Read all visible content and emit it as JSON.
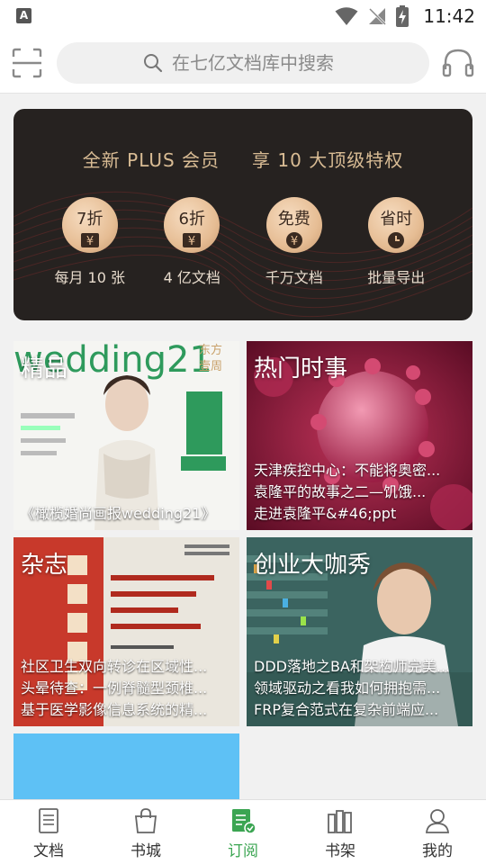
{
  "status_bar": {
    "app_icon_letter": "A",
    "time": "11:42"
  },
  "search": {
    "placeholder": "在七亿文档库中搜索"
  },
  "vip_banner": {
    "title_left": "全新 PLUS 会员",
    "title_right": "享 10 大顶级特权",
    "perks": [
      {
        "badge": "7折",
        "label": "每月 10 张",
        "icon": "yen-coin-icon"
      },
      {
        "badge": "6折",
        "label": "4 亿文档",
        "icon": "yen-coin-icon"
      },
      {
        "badge": "免费",
        "label": "千万文档",
        "icon": "yen-coin-icon"
      },
      {
        "badge": "省时",
        "label": "批量导出",
        "icon": "clock-icon"
      }
    ],
    "colors": {
      "gold": "#d9bc94",
      "background": "#262220"
    }
  },
  "cards": [
    {
      "title": "精品",
      "lines": [
        "《橄榄婚尚画报wedding21》"
      ]
    },
    {
      "title": "热门时事",
      "lines": [
        "天津疾控中心：不能将奥密...",
        "袁隆平的故事之二—饥饿...",
        "走进袁隆平&#46;ppt"
      ]
    },
    {
      "title": "杂志",
      "lines": [
        "社区卫生双向转诊在区域性...",
        "头晕待查：一例脊髓型颈椎...",
        "基于医学影像信息系统的精..."
      ]
    },
    {
      "title": "创业大咖秀",
      "lines": [
        "DDD落地之BA和架构师完美...",
        "领域驱动之看我如何拥抱需...",
        "FRP复合范式在复杂前端应..."
      ]
    }
  ],
  "bottom_nav": {
    "items": [
      {
        "label": "文档",
        "icon": "document-icon",
        "active": false
      },
      {
        "label": "书城",
        "icon": "shopping-bag-icon",
        "active": false
      },
      {
        "label": "订阅",
        "icon": "subscription-icon",
        "active": true
      },
      {
        "label": "书架",
        "icon": "bookshelf-icon",
        "active": false
      },
      {
        "label": "我的",
        "icon": "profile-icon",
        "active": false
      }
    ],
    "active_color": "#3ba552"
  }
}
